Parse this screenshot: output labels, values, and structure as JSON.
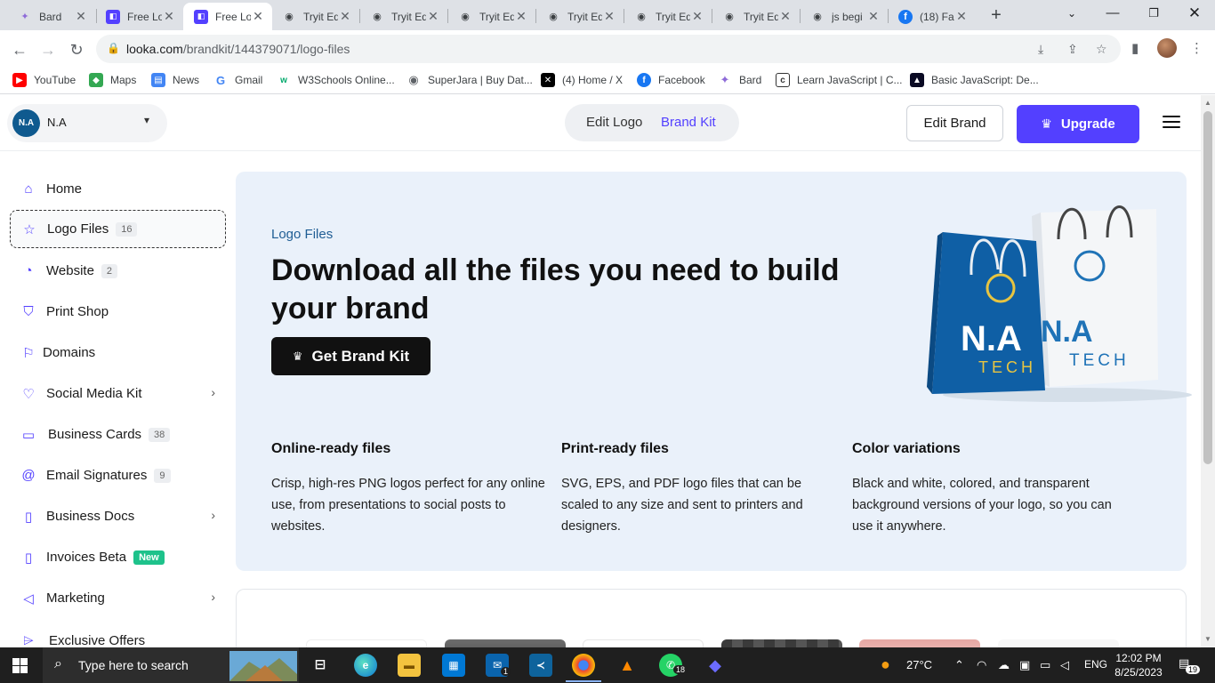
{
  "browser": {
    "tabs": [
      {
        "title": "Bard",
        "icon": "bard-icon",
        "active": false
      },
      {
        "title": "Free Lo",
        "icon": "looka-icon",
        "active": false
      },
      {
        "title": "Free Lo",
        "icon": "looka-icon",
        "active": true
      },
      {
        "title": "Tryit Ed",
        "icon": "globe-icon",
        "active": false
      },
      {
        "title": "Tryit Ed",
        "icon": "globe-icon",
        "active": false
      },
      {
        "title": "Tryit Ed",
        "icon": "globe-icon",
        "active": false
      },
      {
        "title": "Tryit Ed",
        "icon": "globe-icon",
        "active": false
      },
      {
        "title": "Tryit Ed",
        "icon": "globe-icon",
        "active": false
      },
      {
        "title": "Tryit Ed",
        "icon": "globe-icon",
        "active": false
      },
      {
        "title": "js begi",
        "icon": "globe-icon",
        "active": false
      },
      {
        "title": "(18) Fa",
        "icon": "facebook-icon",
        "active": false
      }
    ],
    "url_host": "looka.com",
    "url_path": "/brandkit/144379071/logo-files",
    "bookmarks": [
      {
        "label": "YouTube",
        "color": "#ff0000"
      },
      {
        "label": "Maps",
        "color": "#34a853"
      },
      {
        "label": "News",
        "color": "#4285f4"
      },
      {
        "label": "Gmail",
        "color": "#ea4335"
      },
      {
        "label": "W3Schools Online...",
        "color": "#04aa6d"
      },
      {
        "label": "SuperJara | Buy Dat...",
        "color": "#5f6368"
      },
      {
        "label": "(4) Home / X",
        "color": "#000000"
      },
      {
        "label": "Facebook",
        "color": "#1877f2"
      },
      {
        "label": "Bard",
        "color": "#8e6bd8"
      },
      {
        "label": "Learn JavaScript | C...",
        "color": "#333333"
      },
      {
        "label": "Basic JavaScript: De...",
        "color": "#0a0a23"
      }
    ]
  },
  "header": {
    "brand_initials": "N.A",
    "brand_name": "N.A",
    "edit_logo": "Edit Logo",
    "brand_kit": "Brand Kit",
    "edit_brand": "Edit Brand",
    "upgrade": "Upgrade",
    "accent": "#5340ff"
  },
  "sidebar": {
    "items": [
      {
        "label": "Home",
        "icon": "home-icon"
      },
      {
        "label": "Logo Files",
        "icon": "star-icon",
        "badge": "16",
        "active": true
      },
      {
        "label": "Website",
        "icon": "website-icon",
        "badge": "2"
      },
      {
        "label": "Print Shop",
        "icon": "shirt-icon"
      },
      {
        "label": "Domains",
        "icon": "bookmark-icon"
      },
      {
        "label": "Social Media Kit",
        "icon": "heart-icon",
        "arrow": true
      },
      {
        "label": "Business Cards",
        "icon": "cards-icon",
        "badge": "38"
      },
      {
        "label": "Email Signatures",
        "icon": "at-icon",
        "badge": "9"
      },
      {
        "label": "Business Docs",
        "icon": "doc-icon",
        "arrow": true
      },
      {
        "label": "Invoices Beta",
        "icon": "invoice-icon",
        "new": "New"
      },
      {
        "label": "Marketing",
        "icon": "megaphone-icon",
        "arrow": true
      },
      {
        "label": "Exclusive Offers",
        "icon": "tag-icon"
      }
    ]
  },
  "hero": {
    "kicker": "Logo Files",
    "title": "Download all the files you need to build your brand",
    "cta": "Get Brand Kit",
    "bag_text_main": "N.A",
    "bag_text_sub": "TECH",
    "features": [
      {
        "title": "Online-ready files",
        "body": "Crisp, high-res PNG logos perfect for any online use, from presentations to social posts to websites."
      },
      {
        "title": "Print-ready files",
        "body": "SVG, EPS, and PDF logo files that can be scaled to any size and sent to printers and designers."
      },
      {
        "title": "Color variations",
        "body": "Black and white, colored, and transparent background versions of your logo, so you can use it anywhere."
      }
    ]
  },
  "taskbar": {
    "search_placeholder": "Type here to search",
    "weather": "27°C",
    "language": "ENG",
    "time": "12:02 PM",
    "date": "8/25/2023",
    "notifications": "19",
    "mail_badge": "1",
    "whatsapp_badge": "18"
  }
}
